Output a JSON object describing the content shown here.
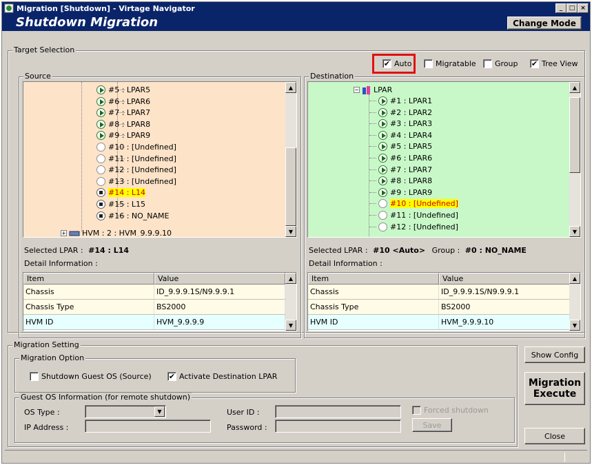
{
  "window": {
    "title": "Migration [Shutdown] - Virtage Navigator"
  },
  "header": {
    "title": "Shutdown Migration",
    "change_mode_label": "Change Mode"
  },
  "target_selection": {
    "label": "Target Selection",
    "options": {
      "auto": {
        "label": "Auto",
        "checked": true
      },
      "migratable": {
        "label": "Migratable",
        "checked": false
      },
      "group": {
        "label": "Group",
        "checked": false
      },
      "tree_view": {
        "label": "Tree View",
        "checked": true
      }
    }
  },
  "source": {
    "label": "Source",
    "tree": [
      {
        "text": "#5 : LPAR5",
        "icon": "play-icon"
      },
      {
        "text": "#6 : LPAR6",
        "icon": "play-icon"
      },
      {
        "text": "#7 : LPAR7",
        "icon": "play-icon"
      },
      {
        "text": "#8 : LPAR8",
        "icon": "play-icon"
      },
      {
        "text": "#9 : LPAR9",
        "icon": "play-icon"
      },
      {
        "text": "#10 : [Undefined]",
        "icon": "empty-icon"
      },
      {
        "text": "#11 : [Undefined]",
        "icon": "empty-icon"
      },
      {
        "text": "#12 : [Undefined]",
        "icon": "empty-icon"
      },
      {
        "text": "#13 : [Undefined]",
        "icon": "empty-icon"
      },
      {
        "text": "#14 : L14",
        "icon": "stop-icon",
        "selected": true
      },
      {
        "text": "#15 : L15",
        "icon": "stop-icon"
      },
      {
        "text": "#16 : NO_NAME",
        "icon": "stop-icon"
      }
    ],
    "hvm_node": "HVM : 2 : HVM_9.9.9.10",
    "selected_label": "Selected LPAR :",
    "selected_value": "#14 : L14",
    "detail_label": "Detail Information :",
    "columns": [
      "Item",
      "Value"
    ],
    "rows": [
      {
        "item": "Chassis",
        "value": "ID_9.9.9.1S/N9.9.9.1"
      },
      {
        "item": "Chassis Type",
        "value": "BS2000"
      },
      {
        "item": "HVM ID",
        "value": "HVM_9.9.9.9"
      }
    ]
  },
  "destination": {
    "label": "Destination",
    "root": "LPAR",
    "tree": [
      {
        "text": "#1 : LPAR1",
        "icon": "play-icon"
      },
      {
        "text": "#2 : LPAR2",
        "icon": "play-icon"
      },
      {
        "text": "#3 : LPAR3",
        "icon": "play-icon"
      },
      {
        "text": "#4 : LPAR4",
        "icon": "play-icon"
      },
      {
        "text": "#5 : LPAR5",
        "icon": "play-icon"
      },
      {
        "text": "#6 : LPAR6",
        "icon": "play-icon"
      },
      {
        "text": "#7 : LPAR7",
        "icon": "play-icon"
      },
      {
        "text": "#8 : LPAR8",
        "icon": "play-icon"
      },
      {
        "text": "#9 : LPAR9",
        "icon": "play-icon"
      },
      {
        "text": "#10 : [Undefined]",
        "icon": "empty-icon",
        "selected": true
      },
      {
        "text": "#11 : [Undefined]",
        "icon": "empty-icon"
      },
      {
        "text": "#12 : [Undefined]",
        "icon": "empty-icon"
      }
    ],
    "selected_label": "Selected LPAR :",
    "selected_value": "#10 <Auto>",
    "group_label": "Group :",
    "group_value": "#0 : NO_NAME",
    "detail_label": "Detail Information :",
    "columns": [
      "Item",
      "Value"
    ],
    "rows": [
      {
        "item": "Chassis",
        "value": "ID_9.9.9.1S/N9.9.9.1"
      },
      {
        "item": "Chassis Type",
        "value": "BS2000"
      },
      {
        "item": "HVM ID",
        "value": "HVM_9.9.9.10"
      }
    ]
  },
  "migration_setting": {
    "label": "Migration Setting",
    "option_label": "Migration Option",
    "shutdown_guest": {
      "label": "Shutdown Guest OS (Source)",
      "checked": false
    },
    "activate_dest": {
      "label": "Activate Destination LPAR",
      "checked": true
    },
    "guest_os_label": "Guest OS Information (for remote shutdown)",
    "os_type_label": "OS Type :",
    "ip_label": "IP Address :",
    "user_label": "User ID :",
    "password_label": "Password :",
    "forced_shutdown": {
      "label": "Forced shutdown",
      "checked": false
    },
    "save_label": "Save"
  },
  "side_buttons": {
    "show_config": "Show Config",
    "migration_execute_1": "Migration",
    "migration_execute_2": "Execute",
    "close": "Close"
  },
  "colors": {
    "source_bg": "#fde3c8",
    "dest_bg": "#c8f8c8",
    "row_chassis_bg": "#fffbe6",
    "row_hvm_bg": "#e6ffff",
    "highlight": "#ffff00",
    "title_bar": "#0a246a"
  }
}
